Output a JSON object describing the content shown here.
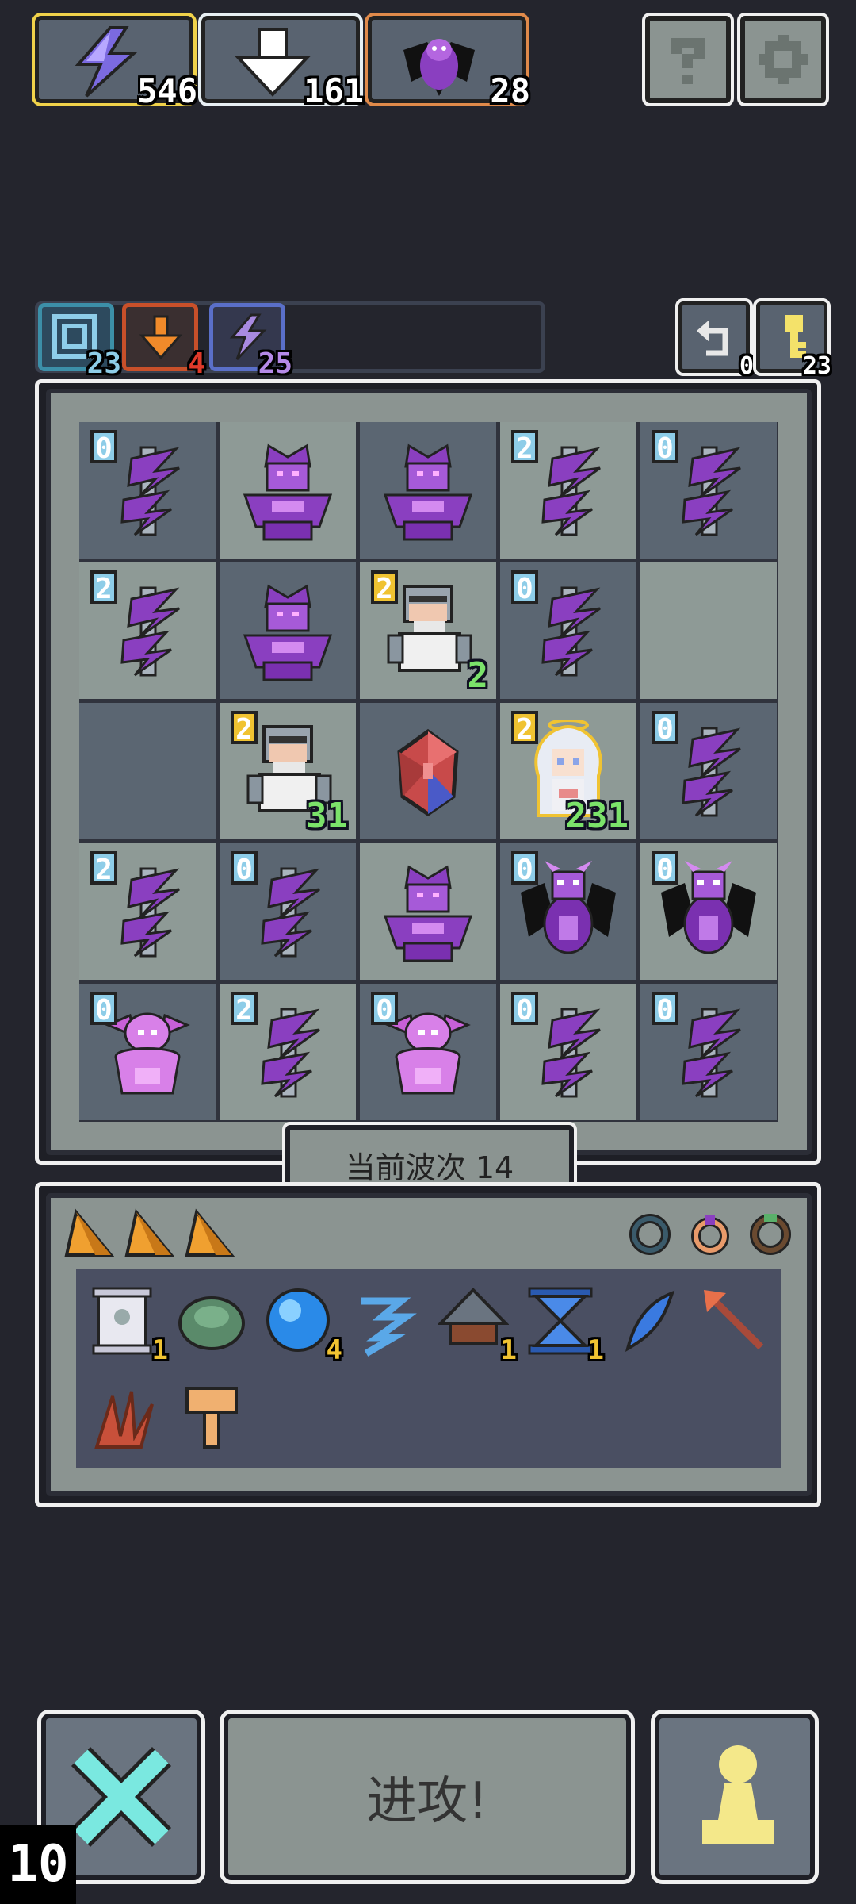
{
  "resources": [
    {
      "name": "energy",
      "value": "546",
      "icon": "lightning-icon",
      "color": "#f0d24a"
    },
    {
      "name": "summon",
      "value": "161",
      "icon": "download-arrow-icon",
      "color": "#e8f0f4"
    },
    {
      "name": "demon",
      "value": "28",
      "icon": "demon-icon",
      "color": "#e08a4a"
    }
  ],
  "top_buttons": {
    "help_icon": "question-icon",
    "settings_icon": "gear-icon"
  },
  "buffs": [
    {
      "icon": "spiral-icon",
      "value": "23",
      "color": "#3c8fa8"
    },
    {
      "icon": "orange-arrow-icon",
      "value": "4",
      "color": "#c8502a"
    },
    {
      "icon": "lightning-icon",
      "value": "25",
      "color": "#5a6fc8"
    }
  ],
  "side_buttons": [
    {
      "icon": "undo-icon",
      "value": "0"
    },
    {
      "icon": "key-icon",
      "value": "23"
    }
  ],
  "board": {
    "cells": [
      {
        "shade": "dark",
        "unit": "lightning-totem",
        "level": "0",
        "lvl_color": "blue"
      },
      {
        "shade": "light",
        "unit": "purple-golem"
      },
      {
        "shade": "dark",
        "unit": "purple-golem"
      },
      {
        "shade": "light",
        "unit": "lightning-totem",
        "level": "2",
        "lvl_color": "blue"
      },
      {
        "shade": "dark",
        "unit": "lightning-totem",
        "level": "0",
        "lvl_color": "blue"
      },
      {
        "shade": "light",
        "unit": "lightning-totem",
        "level": "2",
        "lvl_color": "blue"
      },
      {
        "shade": "dark",
        "unit": "purple-golem"
      },
      {
        "shade": "light",
        "unit": "knight",
        "level": "2",
        "lvl_color": "yellow",
        "hp": "2"
      },
      {
        "shade": "dark",
        "unit": "lightning-totem",
        "level": "0",
        "lvl_color": "blue"
      },
      {
        "shade": "light",
        "unit": ""
      },
      {
        "shade": "dark",
        "unit": ""
      },
      {
        "shade": "light",
        "unit": "knight",
        "level": "2",
        "lvl_color": "yellow",
        "hp": "31"
      },
      {
        "shade": "dark",
        "unit": "crystal"
      },
      {
        "shade": "light",
        "unit": "angel",
        "level": "2",
        "lvl_color": "yellow",
        "hp": "231"
      },
      {
        "shade": "dark",
        "unit": "lightning-totem",
        "level": "0",
        "lvl_color": "blue"
      },
      {
        "shade": "light",
        "unit": "lightning-totem",
        "level": "2",
        "lvl_color": "blue"
      },
      {
        "shade": "dark",
        "unit": "lightning-totem",
        "level": "0",
        "lvl_color": "blue"
      },
      {
        "shade": "light",
        "unit": "purple-golem"
      },
      {
        "shade": "dark",
        "unit": "purple-dragon",
        "level": "0",
        "lvl_color": "blue"
      },
      {
        "shade": "light",
        "unit": "purple-dragon",
        "level": "0",
        "lvl_color": "blue"
      },
      {
        "shade": "dark",
        "unit": "pink-imp",
        "level": "0",
        "lvl_color": "blue"
      },
      {
        "shade": "light",
        "unit": "lightning-totem",
        "level": "2",
        "lvl_color": "blue"
      },
      {
        "shade": "dark",
        "unit": "pink-imp",
        "level": "0",
        "lvl_color": "blue"
      },
      {
        "shade": "light",
        "unit": "lightning-totem",
        "level": "0",
        "lvl_color": "blue"
      },
      {
        "shade": "dark",
        "unit": "lightning-totem",
        "level": "0",
        "lvl_color": "blue"
      }
    ]
  },
  "wave_label": "当前波次 14",
  "inventory": {
    "cheese_count": 3,
    "rings": [
      "dark-ring-icon",
      "gem-ring-icon",
      "green-ring-icon"
    ],
    "items": [
      {
        "icon": "scroll-icon",
        "count": "1"
      },
      {
        "icon": "turtle-shell-icon",
        "count": ""
      },
      {
        "icon": "blue-orb-icon",
        "count": "4"
      },
      {
        "icon": "wind-swirl-icon",
        "count": ""
      },
      {
        "icon": "crossbow-icon",
        "count": "1"
      },
      {
        "icon": "hourglass-icon",
        "count": "1"
      },
      {
        "icon": "blue-feather-icon",
        "count": ""
      },
      {
        "icon": "arrow-icon",
        "count": ""
      },
      {
        "icon": "claw-icon",
        "count": ""
      },
      {
        "icon": "totem-key-icon",
        "count": ""
      }
    ]
  },
  "bottom": {
    "attack_label": "进攻!",
    "cancel_icon": "cross-icon",
    "pawn_icon": "pawn-icon",
    "wave_number": "10"
  }
}
